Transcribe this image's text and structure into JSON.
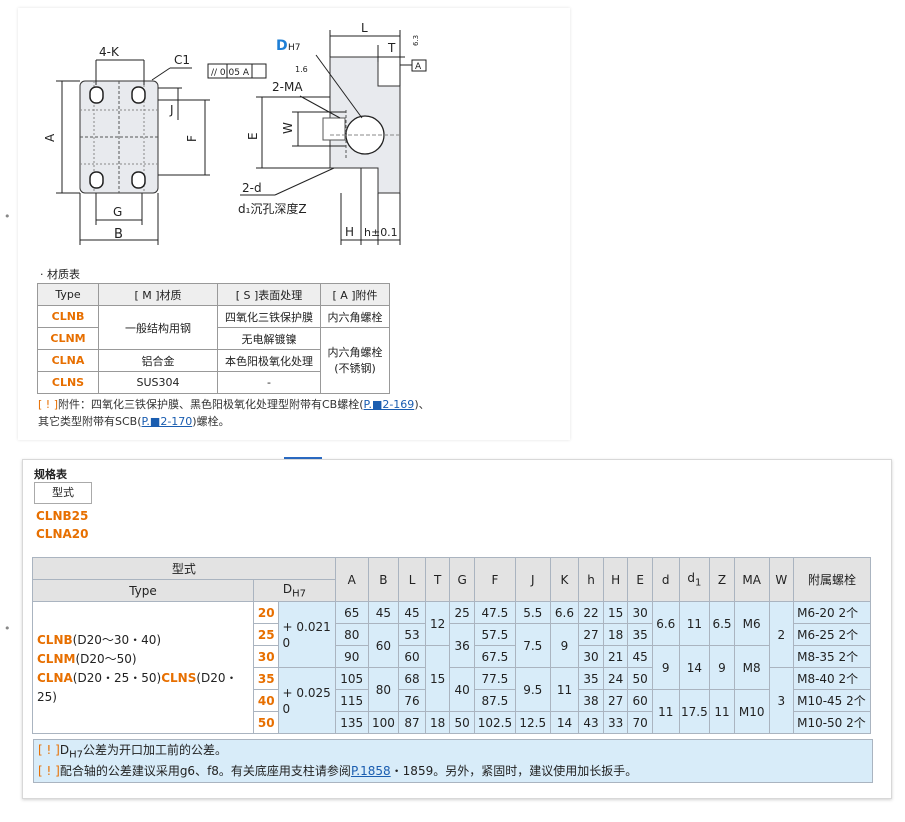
{
  "drawing": {
    "label_4k": "4-K",
    "label_c1": "C1",
    "label_a": "A",
    "label_f": "F",
    "label_j": "J",
    "label_g": "G",
    "label_b": "B",
    "label_d": "D",
    "label_dh7": "H7",
    "label_parallel": "// 0.05 A",
    "label_16": "1.6",
    "label_2ma": "2-MA",
    "label_l": "L",
    "label_t": "T",
    "label_63": "6.3",
    "label_datum_a": "A",
    "label_e": "E",
    "label_w": "W",
    "label_2d": "2-d",
    "label_d1z": "d₁沉孔深度Z",
    "label_h": "H",
    "label_h01": "h±0.1"
  },
  "materials": {
    "caption": "· 材质表",
    "headers": [
      "Type",
      "[ M ]材质",
      "[ S ]表面处理",
      "[ A ]附件"
    ],
    "types": [
      "CLNB",
      "CLNM",
      "CLNA",
      "CLNS"
    ],
    "mat_steel": "一般结构用钢",
    "mat_al": "铝合金",
    "mat_sus": "SUS304",
    "surf_clnb": "四氧化三铁保护膜",
    "surf_clnm": "无电解镀镍",
    "surf_clna": "本色阳极氧化处理",
    "surf_clns": "-",
    "att1": "内六角螺栓",
    "att2": "内六角螺栓",
    "att2b": "(不锈钢)"
  },
  "note1": {
    "ex": "[ ! ]",
    "line1": "附件：四氧化三铁保护膜、黑色阳极氧化处理型附带有CB螺栓(",
    "link1": "P.■2-169",
    "line1_end": ")、",
    "line2": "其它类型附带有SCB(",
    "link2": "P.■2-170",
    "line2_end": ")螺栓。"
  },
  "spec": {
    "title": "规格表",
    "type_button": "型式",
    "models": [
      "CLNB25",
      "CLNA20"
    ],
    "header_xingshi": "型式",
    "header_type": "Type",
    "header_dh7_d": "D",
    "header_dh7_sub": "H7",
    "cols": [
      "A",
      "B",
      "L",
      "T",
      "G",
      "F",
      "J",
      "K",
      "h",
      "H",
      "E",
      "d",
      "d",
      "Z",
      "MA",
      "W",
      "附属螺栓"
    ],
    "d1_sub": "1",
    "type_lines": [
      {
        "name": "CLNB",
        "range": "(D20～30・40)"
      },
      {
        "name": "CLNM",
        "range": "(D20～50)"
      },
      {
        "name": "CLNA",
        "range": "(D20・25・50)",
        "name2": "CLNS",
        "range2": "(D20・25)"
      }
    ],
    "tol1": "+ 0.021",
    "tol1b": "0",
    "tol2": "+ 0.025",
    "tol2b": "0",
    "rows": [
      {
        "D": "20",
        "A": "65",
        "B": "45",
        "L": "45",
        "T": "12",
        "G": "25",
        "F": "47.5",
        "J": "5.5",
        "K": "6.6",
        "h": "22",
        "H": "15",
        "E": "30",
        "d": "6.6",
        "d1": "11",
        "Z": "6.5",
        "MA": "M6",
        "W": "2",
        "bolt": "M6-20 2个"
      },
      {
        "D": "25",
        "A": "80",
        "B": "60",
        "L": "53",
        "G": "36",
        "F": "57.5",
        "J": "7.5",
        "K": "9",
        "h": "27",
        "H": "18",
        "E": "35",
        "bolt": "M6-25 2个"
      },
      {
        "D": "30",
        "A": "90",
        "L": "60",
        "T": "15",
        "F": "67.5",
        "h": "30",
        "H": "21",
        "E": "45",
        "d": "9",
        "d1": "14",
        "Z": "9",
        "MA": "M8",
        "bolt": "M8-35 2个"
      },
      {
        "D": "35",
        "A": "105",
        "B": "80",
        "L": "68",
        "G": "40",
        "F": "77.5",
        "J": "9.5",
        "K": "11",
        "h": "35",
        "H": "24",
        "E": "50",
        "W": "3",
        "bolt": "M8-40 2个"
      },
      {
        "D": "40",
        "A": "115",
        "L": "76",
        "F": "87.5",
        "h": "38",
        "H": "27",
        "E": "60",
        "d": "11",
        "d1": "17.5",
        "Z": "11",
        "MA": "M10",
        "bolt": "M10-45 2个"
      },
      {
        "D": "50",
        "A": "135",
        "B": "100",
        "L": "87",
        "T": "18",
        "G": "50",
        "F": "102.5",
        "J": "12.5",
        "K": "14",
        "h": "43",
        "H": "33",
        "E": "70",
        "bolt": "M10-50 2个"
      }
    ]
  },
  "note2": {
    "ex": "[ ! ]",
    "line1_d": "D",
    "line1_sub": "H7",
    "line1": "公差为开口加工前的公差。",
    "line2": "配合轴的公差建议采用g6、f8。有关底座用支柱请参阅",
    "link": "P.1858",
    "line2_end": "・1859。另外，紧固时，建议使用加长扳手。"
  }
}
